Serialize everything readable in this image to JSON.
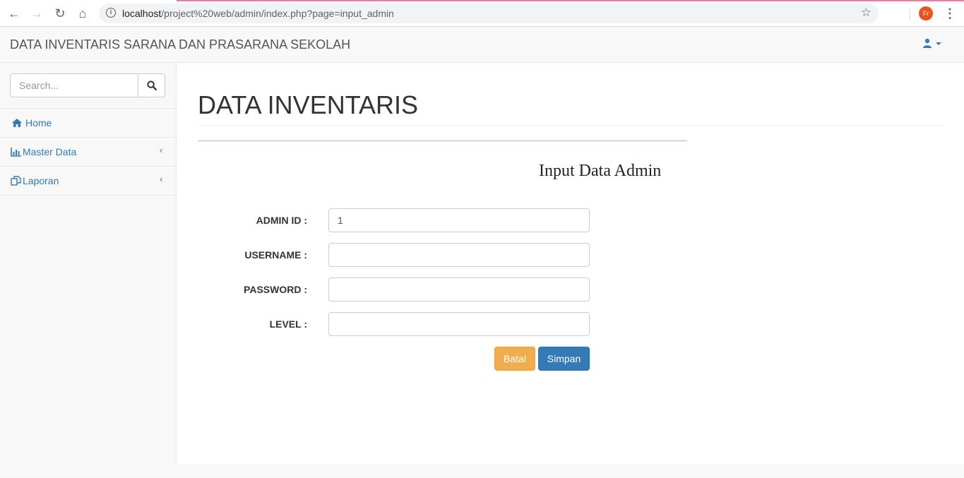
{
  "browser": {
    "url_host": "localhost",
    "url_path": "/project%20web/admin/index.php?page=input_admin",
    "profile_initials": "Fr"
  },
  "navbar": {
    "brand": "DATA INVENTARIS SARANA DAN PRASARANA SEKOLAH",
    "user_icon": "user-icon"
  },
  "sidebar": {
    "search_placeholder": "Search...",
    "items": [
      {
        "label": "Home",
        "icon": "home-icon",
        "has_submenu": false
      },
      {
        "label": "Master Data",
        "icon": "bar-chart-icon",
        "has_submenu": true
      },
      {
        "label": "Laporan",
        "icon": "copy-icon",
        "has_submenu": true
      }
    ]
  },
  "main": {
    "page_title": "DATA INVENTARIS",
    "form_title": "Input Data Admin",
    "fields": [
      {
        "label": "ADMIN ID :",
        "value": "1"
      },
      {
        "label": "USERNAME :",
        "value": ""
      },
      {
        "label": "PASSWORD :",
        "value": ""
      },
      {
        "label": "LEVEL :",
        "value": ""
      }
    ],
    "buttons": {
      "cancel": "Batal",
      "save": "Simpan"
    }
  },
  "colors": {
    "link": "#337ab7",
    "warning": "#f0ad4e",
    "primary": "#337ab7"
  }
}
